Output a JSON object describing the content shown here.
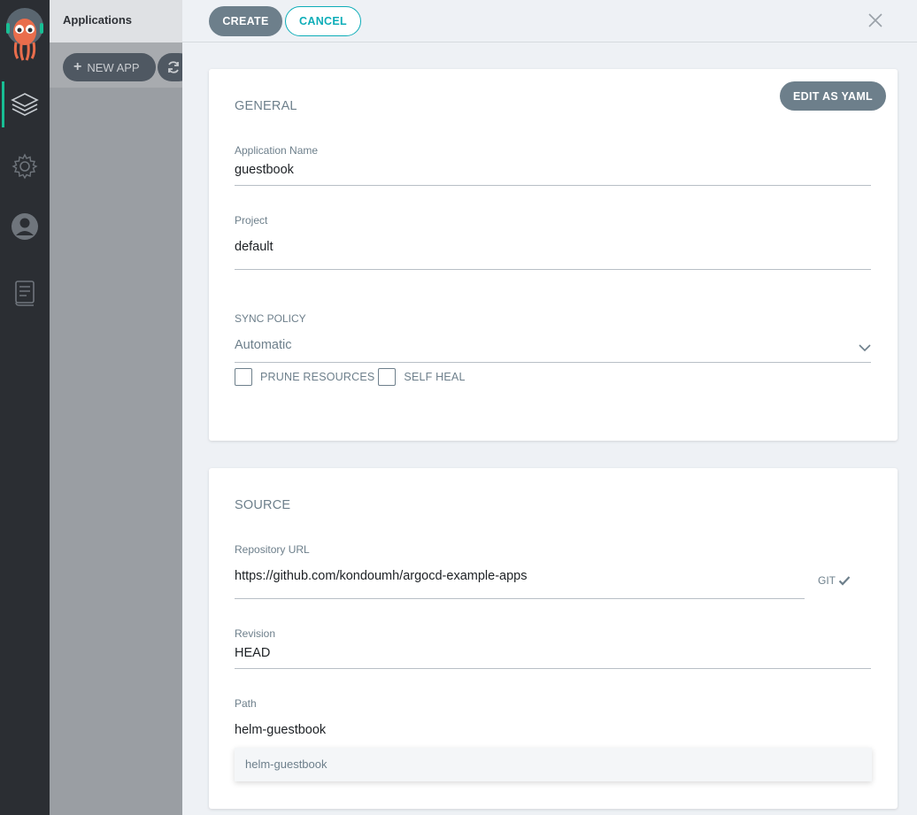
{
  "sidebar_nav": {
    "items": [
      {
        "icon": "layers-icon",
        "active": true
      },
      {
        "icon": "gear-icon",
        "active": false
      },
      {
        "icon": "user-icon",
        "active": false
      },
      {
        "icon": "docs-icon",
        "active": false
      }
    ]
  },
  "apps": {
    "title": "Applications",
    "new_app_label": "NEW APP",
    "refresh_icon": "refresh-icon"
  },
  "panel": {
    "create_label": "CREATE",
    "cancel_label": "CANCEL",
    "close_icon": "close-icon"
  },
  "general": {
    "title": "GENERAL",
    "edit_yaml_label": "EDIT AS YAML",
    "app_name": {
      "label": "Application Name",
      "value": "guestbook"
    },
    "project": {
      "label": "Project",
      "value": "default"
    },
    "sync_policy": {
      "label": "SYNC POLICY",
      "value": "Automatic",
      "prune_label": "PRUNE RESOURCES",
      "prune_checked": false,
      "self_heal_label": "SELF HEAL",
      "self_heal_checked": false
    }
  },
  "source": {
    "title": "SOURCE",
    "repo_url": {
      "label": "Repository URL",
      "value": "https://github.com/kondoumh/argocd-example-apps",
      "type_tag": "GIT"
    },
    "revision": {
      "label": "Revision",
      "value": "HEAD"
    },
    "path": {
      "label": "Path",
      "value": "helm-guestbook",
      "suggestion": "helm-guestbook"
    }
  },
  "colors": {
    "accent": "#0dadb8",
    "active_nav": "#18be94",
    "button_gray": "#6d7f8b"
  }
}
